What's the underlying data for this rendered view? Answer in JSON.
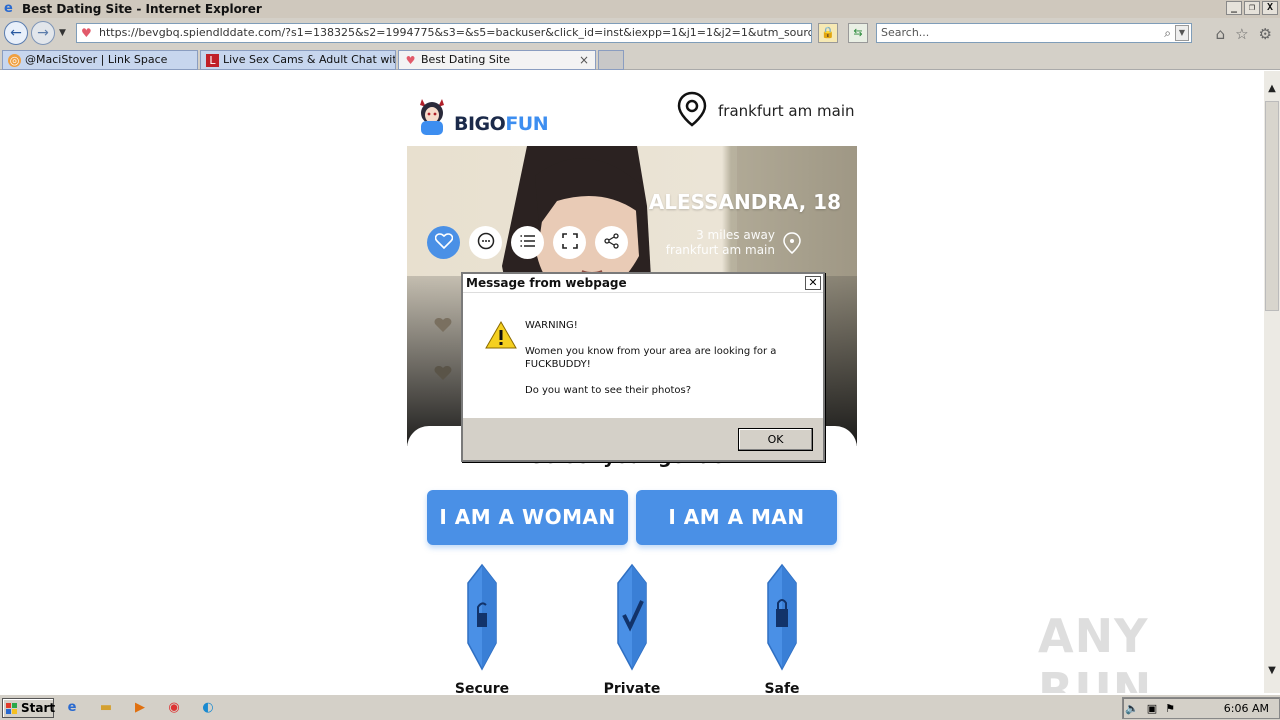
{
  "window": {
    "title": "Best Dating Site - Internet Explorer",
    "controls": [
      "_",
      "❐",
      "X"
    ]
  },
  "address_bar": {
    "url": "https://bevgbq.spiendlddate.com/?s1=138325&s2=1994775&s3=&s5=backuser&click_id=inst&iexpp=1&j1=1&j2=1&utm_source=da57dc555e5",
    "search_placeholder": "Search..."
  },
  "tabs": [
    {
      "label": "@MaciStover | Link Space",
      "icon": "linkspace-icon"
    },
    {
      "label": "Live Sex Cams & Adult Chat wit...",
      "icon": "site-icon"
    },
    {
      "label": "Best Dating Site",
      "icon": "heart-icon",
      "active": true
    }
  ],
  "page": {
    "brand_bigo": "BIGO",
    "brand_fun": "FUN",
    "location": "frankfurt am main",
    "profile": {
      "name_age": "ALESSANDRA, 18",
      "distance": "3 miles away",
      "city": "frankfurt am main"
    },
    "gender_title": "Select your gender",
    "buttons": {
      "woman": "I AM A WOMAN",
      "man": "I AM A MAN"
    },
    "features": [
      "Secure",
      "Private",
      "Safe"
    ],
    "accent_color": "#4a90e6"
  },
  "dialog": {
    "title": "Message from webpage",
    "line1": "WARNING!",
    "line2": "Women you know from your area are looking        for a FUCKBUDDY!",
    "line3": "Do you want to see their photos?",
    "ok": "OK"
  },
  "watermark": "ANY RUN",
  "taskbar": {
    "start": "Start",
    "clock": "6:06 AM"
  }
}
